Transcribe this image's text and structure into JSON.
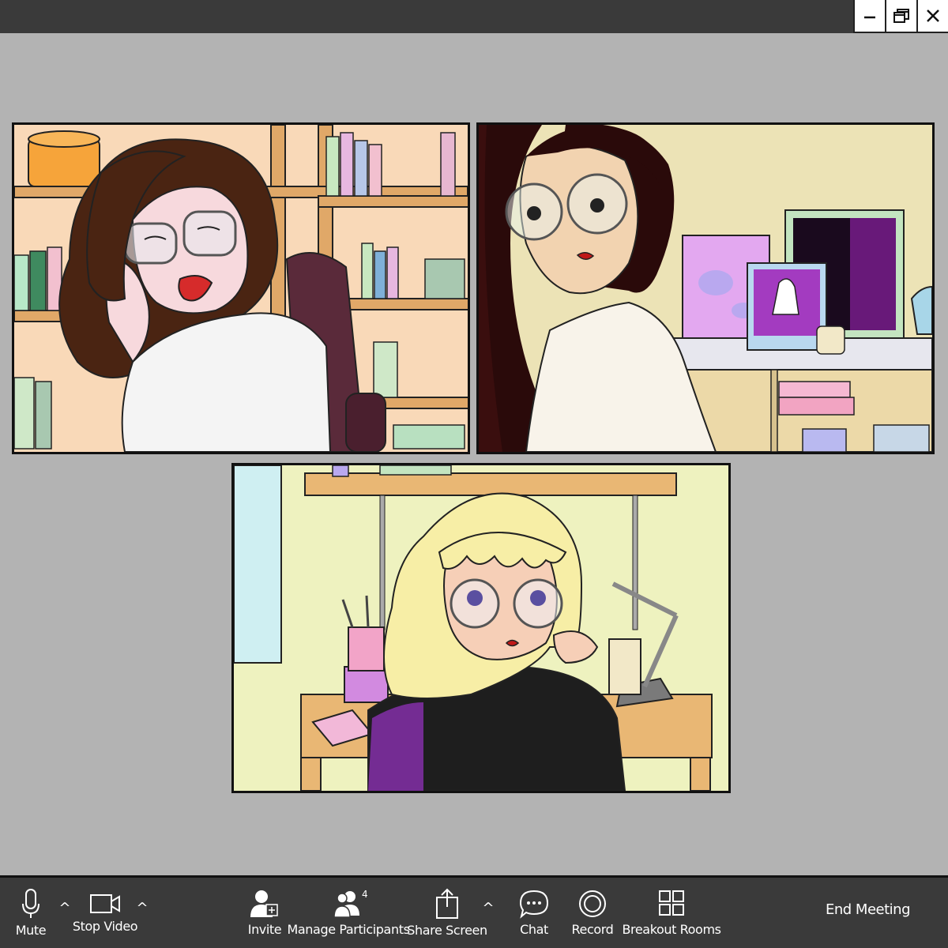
{
  "window": {
    "controls": [
      {
        "name": "minimize-icon"
      },
      {
        "name": "restore-icon"
      },
      {
        "name": "close-icon"
      }
    ]
  },
  "participants": [
    {
      "id": "p1",
      "hair": "#4a2412",
      "skin": "#f7d9dd",
      "top": "#f4f4f4"
    },
    {
      "id": "p2",
      "hair": "#2a0a0a",
      "skin": "#f2d3b0",
      "top": "#f8f3ea"
    },
    {
      "id": "p3",
      "hair": "#f7eea6",
      "skin": "#f6cfb7",
      "top": "#1e1e1e"
    }
  ],
  "toolbar": {
    "mute_label": "Mute",
    "stop_video_label": "Stop Video",
    "invite_label": "Invite",
    "manage_participants_label": "Manage Participants",
    "participant_count": "4",
    "share_screen_label": "Share Screen",
    "chat_label": "Chat",
    "record_label": "Record",
    "breakout_rooms_label": "Breakout Rooms",
    "end_meeting_label": "End Meeting",
    "caret": "^"
  },
  "colors": {
    "titlebar": "#3a3a3a",
    "background": "#b3b3b3",
    "toolbar": "#3a3a3a"
  }
}
